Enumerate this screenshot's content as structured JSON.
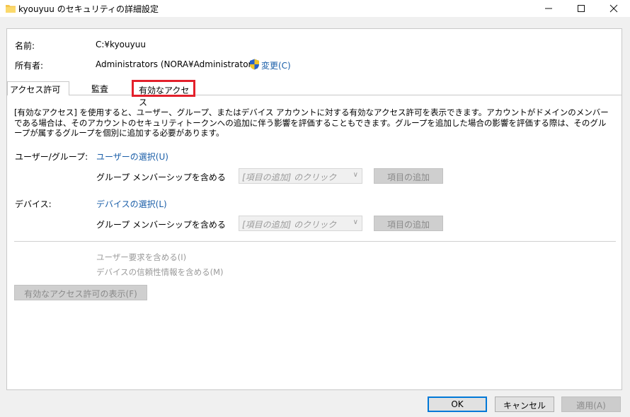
{
  "window": {
    "title": "kyouyuu のセキュリティの詳細設定",
    "minimize_icon": "minimize-icon",
    "maximize_icon": "maximize-icon",
    "close_icon": "close-icon"
  },
  "header": {
    "name_label": "名前:",
    "name_value": "C:¥kyouyuu",
    "owner_label": "所有者:",
    "owner_value": "Administrators (NORA¥Administrators)",
    "change_link": "変更(C)"
  },
  "tabs": [
    {
      "label": "アクセス許可"
    },
    {
      "label": "監査"
    },
    {
      "label": "有効なアクセス",
      "selected": true,
      "highlight_color": "#e3202b"
    }
  ],
  "effective": {
    "description": "[有効なアクセス] を使用すると、ユーザー、グループ、またはデバイス アカウントに対する有効なアクセス許可を表示できます。アカウントがドメインのメンバーである場合は、そのアカウントのセキュリティトークンへの追加に伴う影響を評価することもできます。グループを追加した場合の影響を評価する際は、そのグループが属するグループを個別に追加する必要があります。",
    "user_group_label": "ユーザー/グループ:",
    "user_select_link": "ユーザーの選択(U)",
    "user_group_membership_label": "グループ メンバーシップを含める",
    "user_combo_value": "[項目の追加] のクリック",
    "user_add_button": "項目の追加",
    "device_label": "デバイス:",
    "device_select_link": "デバイスの選択(L)",
    "device_group_membership_label": "グループ メンバーシップを含める",
    "device_combo_value": "[項目の追加] のクリック",
    "device_add_button": "項目の追加",
    "include_user_claims": "ユーザー要求を含める(I)",
    "include_device_claims": "デバイスの信頼性情報を含める(M)",
    "view_button": "有効なアクセス許可の表示(F)"
  },
  "footer": {
    "ok": "OK",
    "cancel": "キャンセル",
    "apply": "適用(A)"
  },
  "colors": {
    "link": "#1a5ea8",
    "ok_border": "#0078d7",
    "tab_highlight": "#e3202b"
  }
}
